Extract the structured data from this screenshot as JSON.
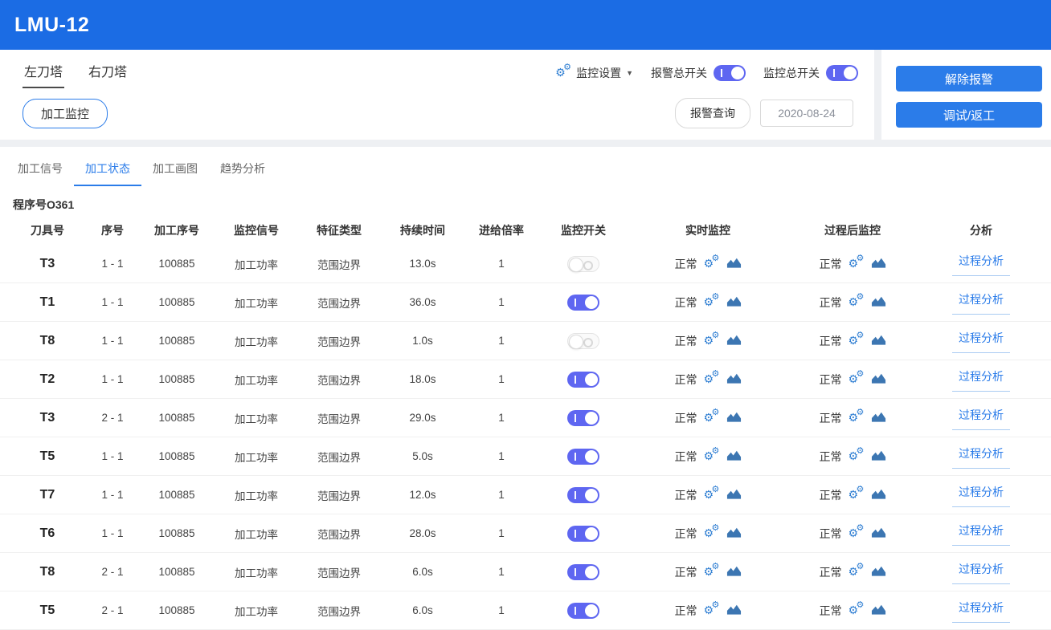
{
  "app": {
    "title": "LMU-12"
  },
  "toolbar": {
    "turret_tabs": [
      {
        "label": "左刀塔",
        "active": true
      },
      {
        "label": "右刀塔",
        "active": false
      }
    ],
    "monitor_button": "加工监控",
    "monitor_settings_label": "监控设置",
    "alarm_master_label": "报警总开关",
    "alarm_master_on": true,
    "monitor_master_label": "监控总开关",
    "monitor_master_on": true,
    "alarm_query_button": "报警查询",
    "date_value": "2020-08-24",
    "clear_alarm_button": "解除报警",
    "debug_rework_button": "调试/返工"
  },
  "tabs": [
    {
      "label": "加工信号",
      "active": false
    },
    {
      "label": "加工状态",
      "active": true
    },
    {
      "label": "加工画图",
      "active": false
    },
    {
      "label": "趋势分析",
      "active": false
    }
  ],
  "program": {
    "label": "程序号",
    "value": "O361"
  },
  "table": {
    "headers": [
      "刀具号",
      "序号",
      "加工序号",
      "监控信号",
      "特征类型",
      "持续时间",
      "进给倍率",
      "监控开关",
      "实时监控",
      "过程后监控",
      "分析"
    ],
    "analysis_label": "过程分析",
    "rows": [
      {
        "tool": "T3",
        "seq": "1 - 1",
        "program_no": "100885",
        "signal": "加工功率",
        "feature": "范围边界",
        "duration": "13.0s",
        "feed": "1",
        "monitor_on": false,
        "realtime": "正常",
        "post": "正常"
      },
      {
        "tool": "T1",
        "seq": "1 - 1",
        "program_no": "100885",
        "signal": "加工功率",
        "feature": "范围边界",
        "duration": "36.0s",
        "feed": "1",
        "monitor_on": true,
        "realtime": "正常",
        "post": "正常"
      },
      {
        "tool": "T8",
        "seq": "1 - 1",
        "program_no": "100885",
        "signal": "加工功率",
        "feature": "范围边界",
        "duration": "1.0s",
        "feed": "1",
        "monitor_on": false,
        "realtime": "正常",
        "post": "正常"
      },
      {
        "tool": "T2",
        "seq": "1 - 1",
        "program_no": "100885",
        "signal": "加工功率",
        "feature": "范围边界",
        "duration": "18.0s",
        "feed": "1",
        "monitor_on": true,
        "realtime": "正常",
        "post": "正常"
      },
      {
        "tool": "T3",
        "seq": "2 - 1",
        "program_no": "100885",
        "signal": "加工功率",
        "feature": "范围边界",
        "duration": "29.0s",
        "feed": "1",
        "monitor_on": true,
        "realtime": "正常",
        "post": "正常"
      },
      {
        "tool": "T5",
        "seq": "1 - 1",
        "program_no": "100885",
        "signal": "加工功率",
        "feature": "范围边界",
        "duration": "5.0s",
        "feed": "1",
        "monitor_on": true,
        "realtime": "正常",
        "post": "正常"
      },
      {
        "tool": "T7",
        "seq": "1 - 1",
        "program_no": "100885",
        "signal": "加工功率",
        "feature": "范围边界",
        "duration": "12.0s",
        "feed": "1",
        "monitor_on": true,
        "realtime": "正常",
        "post": "正常"
      },
      {
        "tool": "T6",
        "seq": "1 - 1",
        "program_no": "100885",
        "signal": "加工功率",
        "feature": "范围边界",
        "duration": "28.0s",
        "feed": "1",
        "monitor_on": true,
        "realtime": "正常",
        "post": "正常"
      },
      {
        "tool": "T8",
        "seq": "2 - 1",
        "program_no": "100885",
        "signal": "加工功率",
        "feature": "范围边界",
        "duration": "6.0s",
        "feed": "1",
        "monitor_on": true,
        "realtime": "正常",
        "post": "正常"
      },
      {
        "tool": "T5",
        "seq": "2 - 1",
        "program_no": "100885",
        "signal": "加工功率",
        "feature": "范围边界",
        "duration": "6.0s",
        "feed": "1",
        "monitor_on": true,
        "realtime": "正常",
        "post": "正常"
      }
    ]
  },
  "icons": {
    "gear": "⚙",
    "caret_down": "▼"
  },
  "colors": {
    "header_blue": "#1b6ce4",
    "accent_blue": "#2b7ce9",
    "toggle_on": "#5e66f1",
    "gear_blue": "#2d7dd2",
    "chart_blue": "#3c76b2"
  }
}
